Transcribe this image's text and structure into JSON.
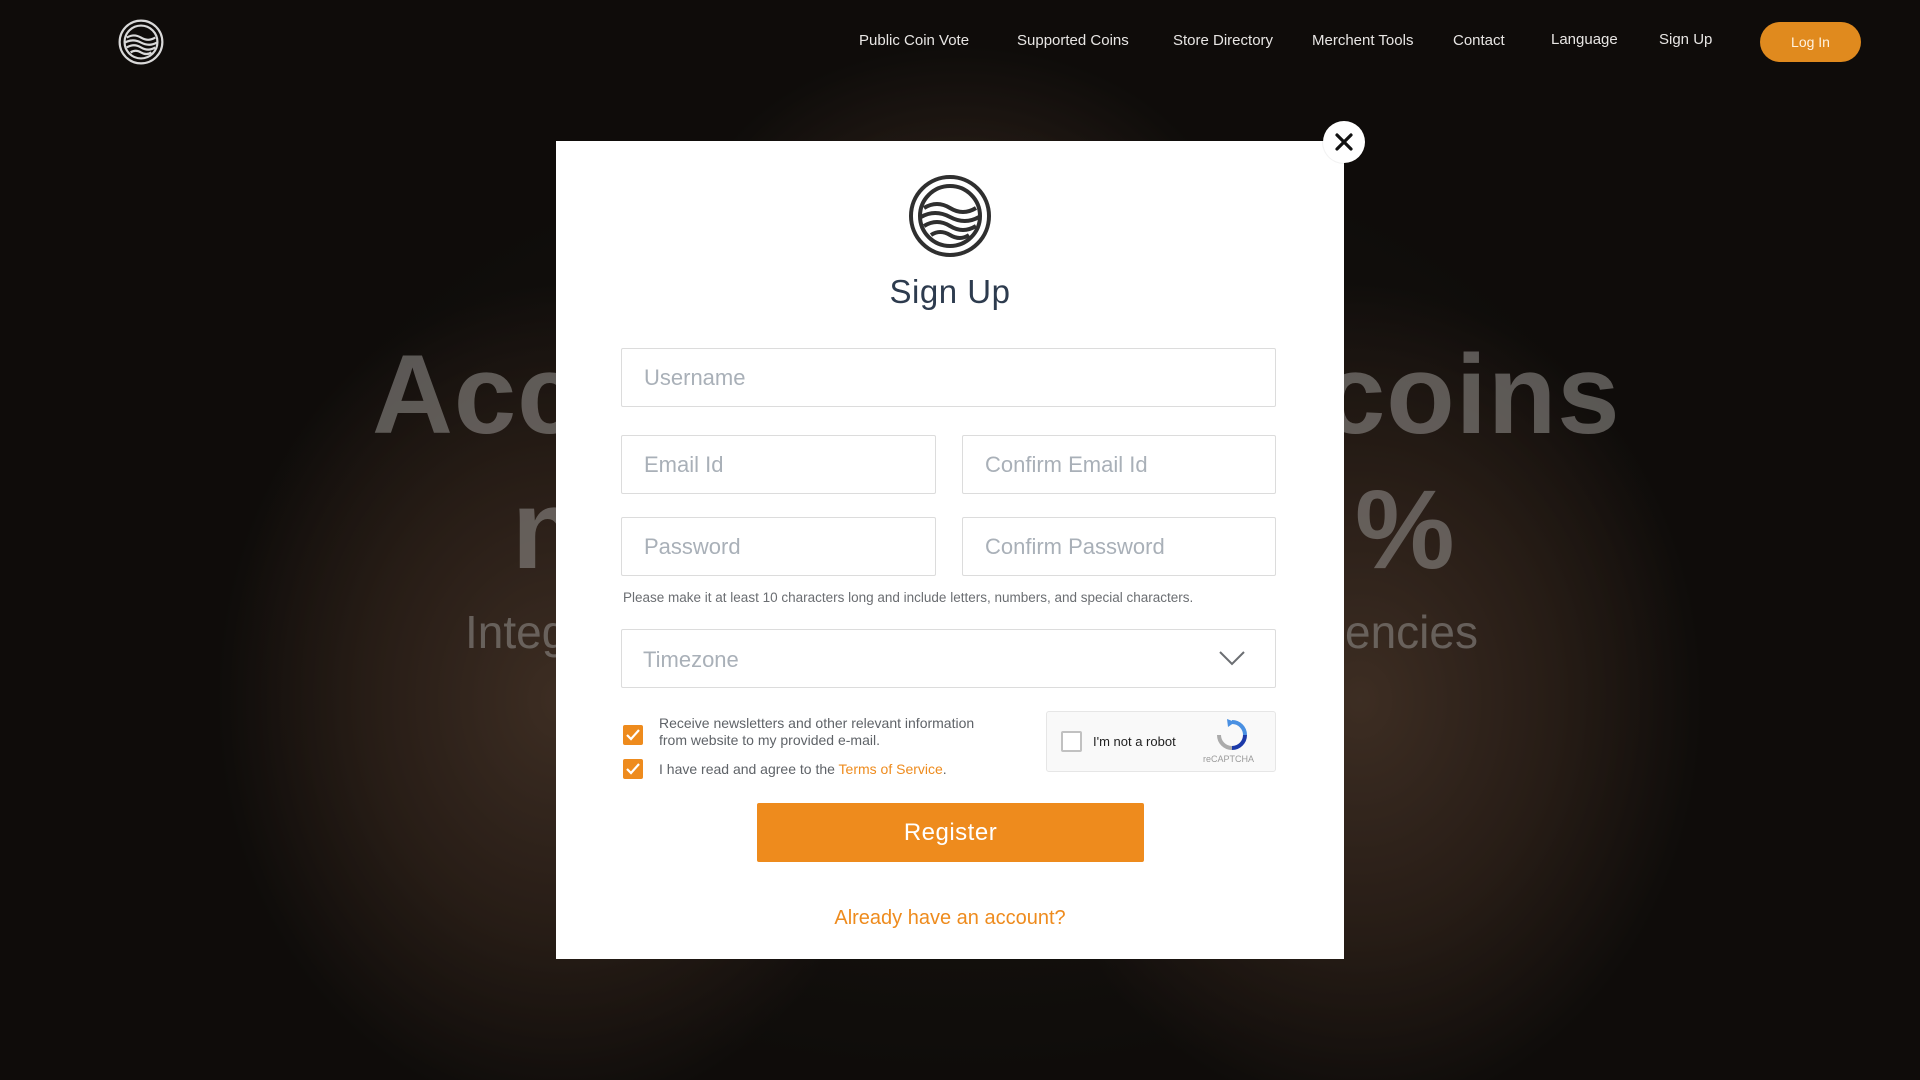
{
  "nav": {
    "logo_icon": "wave-circle-logo-icon",
    "links": [
      {
        "label": "Public Coin Vote"
      },
      {
        "label": "Supported Coins"
      },
      {
        "label": "Store Directory"
      },
      {
        "label": "Merchent Tools"
      },
      {
        "label": "Contact"
      },
      {
        "label": "Language"
      },
      {
        "label": "Sign Up"
      }
    ],
    "login_label": "Log In"
  },
  "hero": {
    "line1_left": "Acc",
    "line1_right": "coins",
    "line2_left": "n",
    "line2_right": "%",
    "line3_left": "Integ",
    "line3_right": "encies"
  },
  "modal": {
    "close_icon": "close-icon",
    "logo_icon": "wave-circle-logo-icon",
    "title": "Sign Up",
    "fields": {
      "username": {
        "placeholder": "Username",
        "value": ""
      },
      "email": {
        "placeholder": "Email Id",
        "value": ""
      },
      "confirm_email": {
        "placeholder": "Confirm Email Id",
        "value": ""
      },
      "password": {
        "placeholder": "Password",
        "value": ""
      },
      "confirm_password": {
        "placeholder": "Confirm Password",
        "value": ""
      }
    },
    "password_hint": "Please make it at least 10 characters long and include letters, numbers, and special characters.",
    "timezone": {
      "selected": "Timezone",
      "icon": "chevron-down-icon"
    },
    "newsletter": {
      "checked": true,
      "label_line1": "Receive newsletters and other relevant information",
      "label_line2": "from website to my provided e-mail."
    },
    "terms": {
      "checked": true,
      "label_prefix": "I have read and agree to the ",
      "link_text": "Terms of Service",
      "label_suffix": "."
    },
    "recaptcha": {
      "label": "I'm not a robot",
      "brand": "reCAPTCHA",
      "icon": "recaptcha-icon"
    },
    "register_label": "Register",
    "account_link": "Already have an account?"
  },
  "colors": {
    "accent": "#ee8b1d",
    "title": "#2d3b4e",
    "placeholder": "#a9b0b8"
  }
}
